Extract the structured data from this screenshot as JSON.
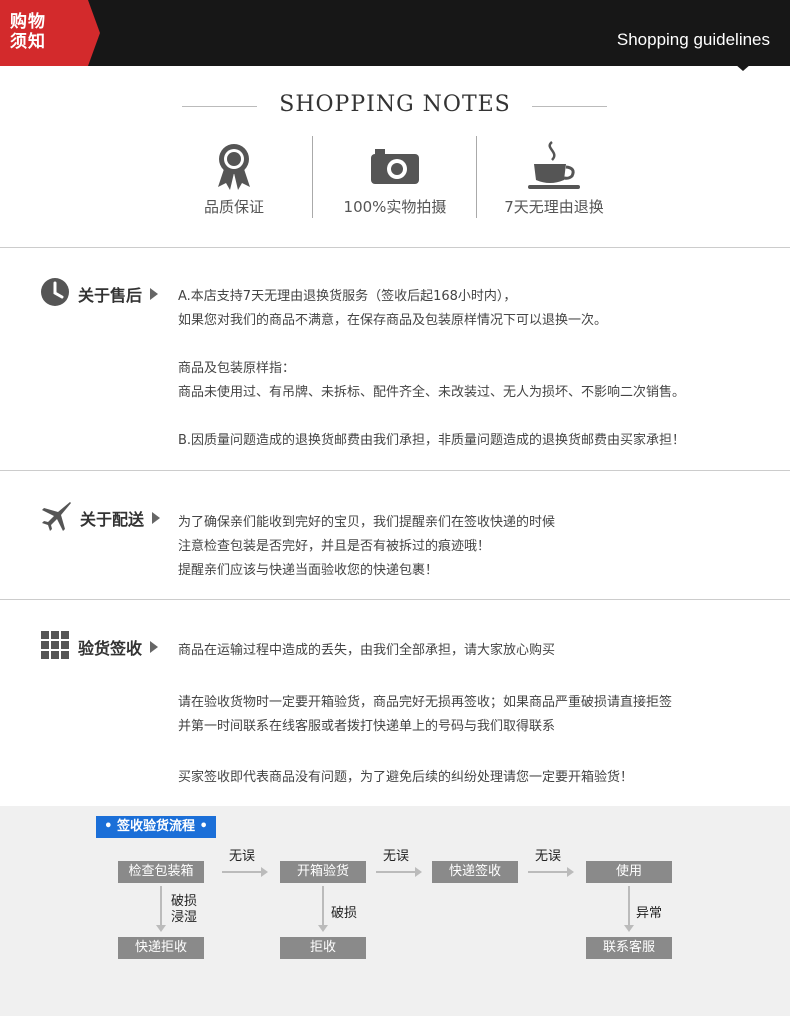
{
  "header": {
    "tag_line1": "购物",
    "tag_line2": "须知",
    "guide": "Shopping guidelines"
  },
  "notes": {
    "title": "SHOPPING NOTES",
    "features": [
      {
        "icon": "award-ribbon-icon",
        "label": "品质保证"
      },
      {
        "icon": "camera-icon",
        "label": "100%实物拍摄"
      },
      {
        "icon": "coffee-cup-icon",
        "label": "7天无理由退换"
      }
    ]
  },
  "sections": {
    "after_sales": {
      "icon": "clock-icon",
      "title": "关于售后",
      "lines": [
        "A.本店支持7天无理由退换货服务（签收后起168小时内），",
        "如果您对我们的商品不满意，在保存商品及包装原样情况下可以退换一次。",
        "商品及包装原样指：",
        "商品未使用过、有吊牌、未拆标、配件齐全、未改装过、无人为损坏、不影响二次销售。",
        "B.因质量问题造成的退换货邮费由我们承担，非质量问题造成的退换货邮费由买家承担！"
      ]
    },
    "shipping": {
      "icon": "airplane-icon",
      "title": "关于配送",
      "lines": [
        "为了确保亲们能收到完好的宝贝，我们提醒亲们在签收快递的时候",
        "注意检查包装是否完好，并且是否有被拆过的痕迹哦！",
        "提醒亲们应该与快递当面验收您的快递包裹！"
      ]
    },
    "inspection": {
      "icon": "grid-icon",
      "title": "验货签收",
      "lines": [
        "商品在运输过程中造成的丢失，由我们全部承担，请大家放心购买",
        "请在验收货物时一定要开箱验货，商品完好无损再签收；如果商品严重破损请直接拒签",
        "并第一时间联系在线客服或者拨打快递单上的号码与我们取得联系",
        "买家签收即代表商品没有问题，为了避免后续的纠纷处理请您一定要开箱验货！"
      ]
    }
  },
  "flow": {
    "tag": "• 签收验货流程 •",
    "steps": [
      "检查包装箱",
      "开箱验货",
      "快递签收",
      "使用"
    ],
    "outcomes": [
      "快递拒收",
      "拒收",
      "联系客服"
    ],
    "ok_label": "无误",
    "down_labels": [
      "破损\n浸湿",
      "破损",
      "异常"
    ]
  }
}
